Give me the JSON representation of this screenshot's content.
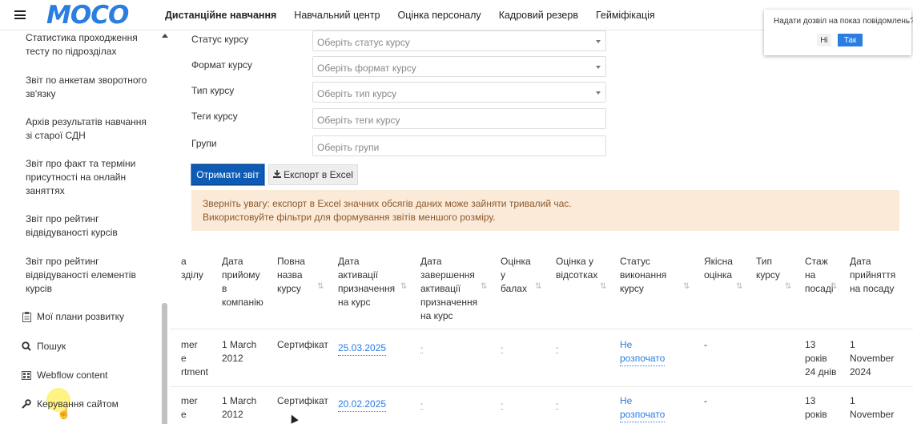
{
  "header": {
    "logo": "MOCO",
    "nav": [
      "Дистанційне навчання",
      "Навчальний центр",
      "Оцінка персоналу",
      "Кадровий резерв",
      "Гейміфікація"
    ]
  },
  "sidebar": {
    "reports": [
      "Статистика проходження тесту по підрозділах",
      "Звіт по анкетам зворотного зв'язку",
      "Архів результатів навчання зі старої СДН",
      "Звіт про факт та терміни присутності на онлайн заняттях",
      "Звіт про рейтинг відвідуваності курсів",
      "Звіт про рейтинг відвідуваності елементів курсів"
    ],
    "items": [
      {
        "icon": "clipboard-icon",
        "label": "Мої плани розвитку"
      },
      {
        "icon": "search-icon",
        "label": "Пошук"
      },
      {
        "icon": "webflow-icon",
        "label": "Webflow content"
      },
      {
        "icon": "wrench-icon",
        "label": "Керування сайтом"
      }
    ]
  },
  "filters": [
    {
      "label": "Статус курсу",
      "placeholder": "Оберіть статус курсу",
      "type": "select"
    },
    {
      "label": "Формат курсу",
      "placeholder": "Оберіть формат курсу",
      "type": "select"
    },
    {
      "label": "Тип курсу",
      "placeholder": "Оберіть тип курсу",
      "type": "select"
    },
    {
      "label": "Теги курсу",
      "placeholder": "Оберіть теги курсу",
      "type": "input"
    },
    {
      "label": "Групи",
      "placeholder": "Оберіть групи",
      "type": "input"
    }
  ],
  "buttons": {
    "get_report": "Отримати звіт",
    "export_excel": "Експорт в Excel"
  },
  "warning": [
    "Зверніть увагу: експорт в Excel значних обсягів даних може зайняти тривалий час.",
    "Використовуйте фільтри для формування звітів меншого розміру."
  ],
  "table": {
    "columns": [
      {
        "label": "а\nзділу"
      },
      {
        "label": "Дата\nприйому\nв\nкомпанію"
      },
      {
        "label": "Повна\nназва\nкурсу"
      },
      {
        "label": "Дата\nактивації\nпризначення\nна курс"
      },
      {
        "label": "Дата\nзавершення\nактивації\nпризначення\nна курс"
      },
      {
        "label": "Оцінка\nу\nбалах"
      },
      {
        "label": "Оцінка у\nвідсотках"
      },
      {
        "label": "Статус\nвиконання\nкурсу"
      },
      {
        "label": "Якісна\nоцінка"
      },
      {
        "label": "Тип\nкурсу"
      },
      {
        "label": "Стаж\nна\nпосаді"
      },
      {
        "label": "Дата\nприйняття\nна посаду"
      }
    ],
    "rows": [
      {
        "dept": "mer\ne\nrtment",
        "hire_date": "1 March\n2012",
        "course": "Сертифікат",
        "activation": "25.03.2025",
        "completion": "-",
        "score": "-",
        "percent": "-",
        "status": "Не\nрозпочато",
        "quality": "-",
        "ctype": "",
        "tenure": "13\nроків\n24 днів",
        "position_date": "1\nNovember\n2024"
      },
      {
        "dept": "mer\ne",
        "hire_date": "1 March\n2012",
        "course": "Сертифікат",
        "activation": "20.02.2025",
        "completion": "-",
        "score": "-",
        "percent": "-",
        "status": "Не\nрозпочато",
        "quality": "-",
        "ctype": "",
        "tenure": "13\nроків",
        "position_date": "1\nNovember"
      }
    ]
  },
  "notification": {
    "text": "Надати дозвіл на показ повідомлень?",
    "no": "Ні",
    "yes": "Так"
  },
  "colors": {
    "accent": "#2a7de1",
    "primary_button": "#0d5bb5",
    "warning_bg": "#fcead9"
  }
}
